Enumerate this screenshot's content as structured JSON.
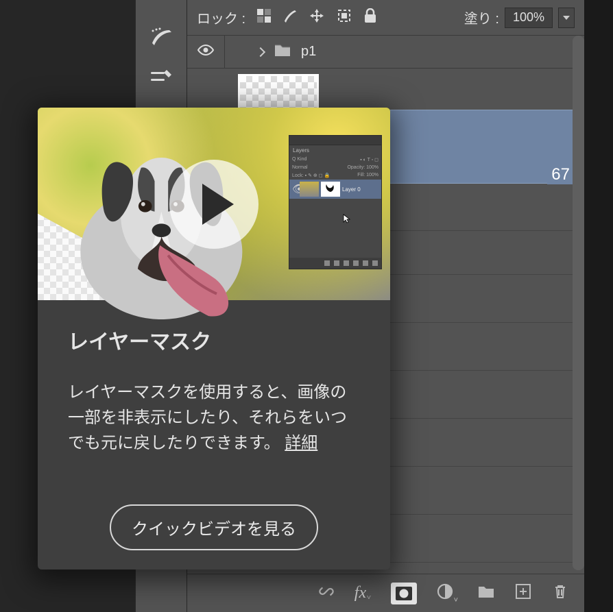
{
  "top": {
    "lock_label": "ロック :",
    "fill_label": "塗り :",
    "fill_value": "100%"
  },
  "group": {
    "name": "p1"
  },
  "selected_layer": {
    "partial": "67"
  },
  "tooltip": {
    "title": "レイヤーマスク",
    "description": "レイヤーマスクを使用すると、画像の一部を非表示にしたり、それらをいつでも元に戻したりできます。 ",
    "more": "詳細",
    "cta": "クイックビデオを見る",
    "mini_panel_label": "Layers",
    "mini_layer_name": "Layer 0",
    "mini_opacity_label": "Opacity: 100%",
    "mini_fill_label": "Fill: 100%",
    "mini_blend": "Normal",
    "mini_kind": "Kind"
  }
}
